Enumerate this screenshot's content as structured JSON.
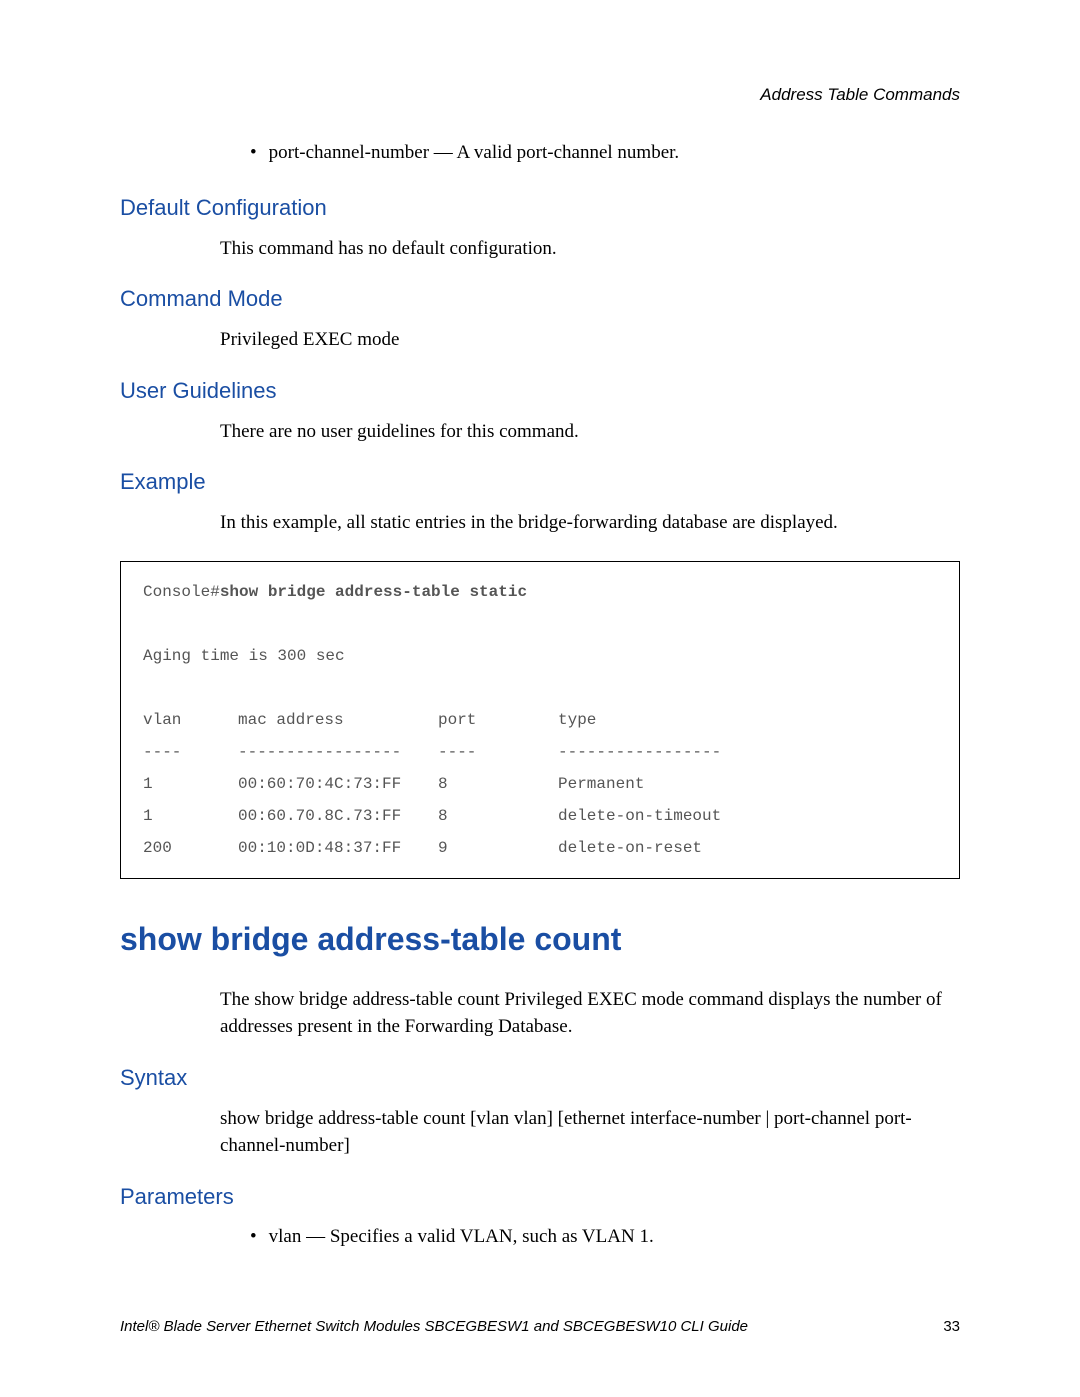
{
  "header": {
    "section": "Address Table Commands"
  },
  "bullets": {
    "portchannel": "port-channel-number — A valid port-channel number.",
    "vlan": "vlan — Specifies a valid VLAN, such as VLAN 1."
  },
  "sections": {
    "defaultconfig": {
      "title": "Default Configuration",
      "body": "This command has no default configuration."
    },
    "commandmode": {
      "title": "Command Mode",
      "body": "Privileged EXEC mode"
    },
    "userguidelines": {
      "title": "User Guidelines",
      "body": "There are no user guidelines for this command."
    },
    "example": {
      "title": "Example",
      "body": "In this example, all static entries in the bridge-forwarding database are displayed."
    },
    "syntax": {
      "title": "Syntax",
      "body": "show bridge address-table count [vlan vlan] [ethernet interface-number | port-channel port-channel-number]"
    },
    "parameters": {
      "title": "Parameters"
    }
  },
  "code": {
    "prompt": "Console# ",
    "cmd": "show bridge address-table static",
    "aging": "Aging time is 300 sec",
    "header": {
      "vlan": "vlan",
      "mac": "mac address",
      "port": "port",
      "type": "type"
    },
    "sep": {
      "vlan": "----",
      "mac": "-----------------",
      "port": "----",
      "type": "-----------------"
    },
    "rows": [
      {
        "vlan": "1",
        "mac": "00:60:70:4C:73:FF",
        "port": "8",
        "type": "Permanent"
      },
      {
        "vlan": "1",
        "mac": "00:60.70.8C.73:FF",
        "port": "8",
        "type": "delete-on-timeout"
      },
      {
        "vlan": "200",
        "mac": "00:10:0D:48:37:FF",
        "port": "9",
        "type": "delete-on-reset"
      }
    ]
  },
  "command_heading": "show bridge address-table count",
  "command_desc": "The show bridge address-table count Privileged EXEC mode command displays the number of addresses present in the Forwarding Database.",
  "footer": {
    "left": "Intel® Blade Server Ethernet Switch Modules SBCEGBESW1 and SBCEGBESW10 CLI Guide",
    "page": "33"
  }
}
